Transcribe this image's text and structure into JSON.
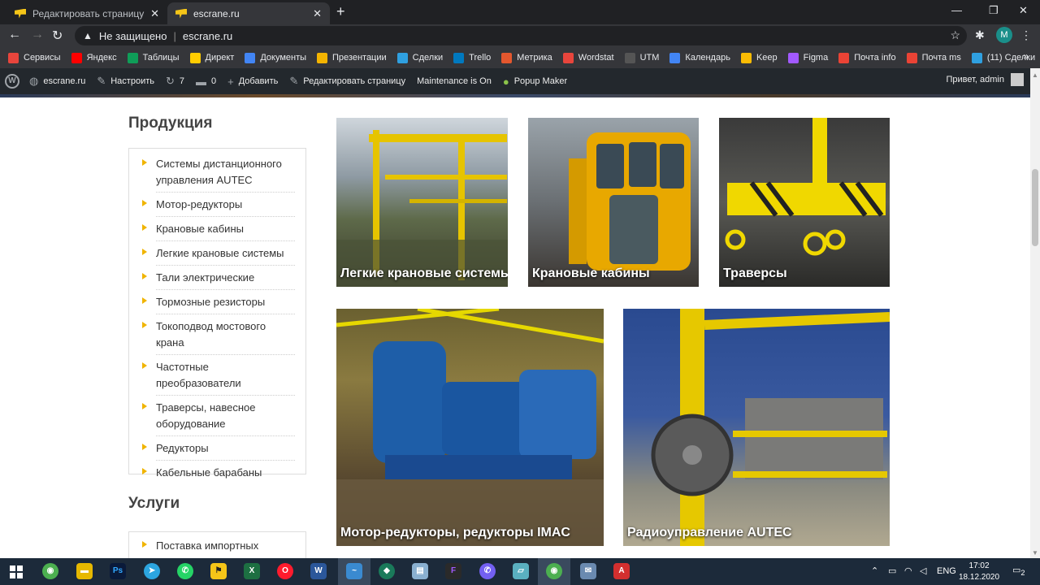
{
  "browser": {
    "tabs": [
      {
        "title": "Редактировать страницу ‹ — W",
        "active": false
      },
      {
        "title": "escrane.ru",
        "active": true
      }
    ],
    "url_warning": "Не защищено",
    "url": "escrane.ru",
    "profile_initial": "M"
  },
  "bookmarks": [
    {
      "label": "Сервисы",
      "color": "#e8453c"
    },
    {
      "label": "Яндекс",
      "color": "#ff0000"
    },
    {
      "label": "Таблицы",
      "color": "#0f9d58"
    },
    {
      "label": "Директ",
      "color": "#ffcc00"
    },
    {
      "label": "Документы",
      "color": "#4285f4"
    },
    {
      "label": "Презентации",
      "color": "#f4b400"
    },
    {
      "label": "Сделки",
      "color": "#2fa0e0"
    },
    {
      "label": "Trello",
      "color": "#0079bf"
    },
    {
      "label": "Метрика",
      "color": "#e4572e"
    },
    {
      "label": "Wordstat",
      "color": "#e8453c"
    },
    {
      "label": "UTM",
      "color": "#555555"
    },
    {
      "label": "Календарь",
      "color": "#4285f4"
    },
    {
      "label": "Keep",
      "color": "#fbbc04"
    },
    {
      "label": "Figma",
      "color": "#a259ff"
    },
    {
      "label": "Почта info",
      "color": "#ea4335"
    },
    {
      "label": "Почта ms",
      "color": "#ea4335"
    },
    {
      "label": "(11) Сделки",
      "color": "#2fa0e0"
    }
  ],
  "wpbar": {
    "site": "escrane.ru",
    "customize": "Настроить",
    "updates": "7",
    "comments": "0",
    "add": "Добавить",
    "edit": "Редактировать страницу",
    "maintenance": "Maintenance is On",
    "popup": "Popup Maker",
    "greeting": "Привет, admin"
  },
  "sidebar": {
    "products_heading": "Продукция",
    "products": [
      "Системы дистанционного управления AUTEC",
      "Мотор-редукторы",
      "Крановые кабины",
      "Легкие крановые системы",
      "Тали электрические",
      "Тормозные резисторы",
      "Токоподвод мостового крана",
      "Частотные преобразователи",
      "Траверсы, навесное оборудование",
      "Редукторы",
      "Кабельные барабаны"
    ],
    "services_heading": "Услуги",
    "services": [
      "Поставка импортных"
    ]
  },
  "cards": [
    {
      "caption": "Легкие крановые системы"
    },
    {
      "caption": "Крановые кабины"
    },
    {
      "caption": "Траверсы"
    },
    {
      "caption": "Мотор-редукторы, редукторы IMAC"
    },
    {
      "caption": "Радиоуправление AUTEC"
    }
  ],
  "taskbar": {
    "lang": "ENG",
    "time": "17:02",
    "date": "18.12.2020",
    "notifications": "2"
  }
}
